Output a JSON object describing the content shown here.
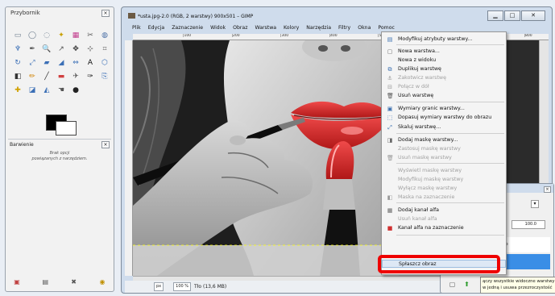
{
  "toolbox": {
    "title": "Przybornik",
    "tools": [
      {
        "name": "rect-select-icon",
        "glyph": "▭",
        "color": "#6b7b8c"
      },
      {
        "name": "ellipse-select-icon",
        "glyph": "◯",
        "color": "#6b7b8c"
      },
      {
        "name": "free-select-icon",
        "glyph": "◌",
        "color": "#6b7b8c"
      },
      {
        "name": "fuzzy-select-icon",
        "glyph": "✦",
        "color": "#c8a000"
      },
      {
        "name": "color-select-icon",
        "glyph": "▦",
        "color": "#c23b8c"
      },
      {
        "name": "scissors-icon",
        "glyph": "✂",
        "color": "#555555"
      },
      {
        "name": "foreground-select-icon",
        "glyph": "◍",
        "color": "#4a6fa5"
      },
      {
        "name": "paths-icon",
        "glyph": "♆",
        "color": "#3b6fb6"
      },
      {
        "name": "color-picker-icon",
        "glyph": "✒",
        "color": "#555555"
      },
      {
        "name": "zoom-icon",
        "glyph": "🔍",
        "color": "#3b6fb6"
      },
      {
        "name": "measure-icon",
        "glyph": "↗",
        "color": "#555555"
      },
      {
        "name": "move-icon",
        "glyph": "✥",
        "color": "#333333"
      },
      {
        "name": "align-icon",
        "glyph": "⊹",
        "color": "#333333"
      },
      {
        "name": "crop-icon",
        "glyph": "⌗",
        "color": "#666666"
      },
      {
        "name": "rotate-icon",
        "glyph": "↻",
        "color": "#3b6fb6"
      },
      {
        "name": "scale-icon",
        "glyph": "⤢",
        "color": "#3b6fb6"
      },
      {
        "name": "shear-icon",
        "glyph": "▰",
        "color": "#3b6fb6"
      },
      {
        "name": "perspective-icon",
        "glyph": "◢",
        "color": "#3b6fb6"
      },
      {
        "name": "flip-icon",
        "glyph": "⇔",
        "color": "#3b6fb6"
      },
      {
        "name": "text-icon",
        "glyph": "A",
        "color": "#111111"
      },
      {
        "name": "cage-icon",
        "glyph": "⬡",
        "color": "#3b6fb6"
      },
      {
        "name": "bucket-fill-icon",
        "glyph": "◧",
        "color": "#333333"
      },
      {
        "name": "pencil-icon",
        "glyph": "✏",
        "color": "#d08000"
      },
      {
        "name": "paintbrush-icon",
        "glyph": "╱",
        "color": "#333333"
      },
      {
        "name": "eraser-icon",
        "glyph": "▬",
        "color": "#d04040"
      },
      {
        "name": "airbrush-icon",
        "glyph": "✈",
        "color": "#555555"
      },
      {
        "name": "ink-icon",
        "glyph": "✑",
        "color": "#333333"
      },
      {
        "name": "clone-icon",
        "glyph": "⎘",
        "color": "#3b6fb6"
      },
      {
        "name": "heal-icon",
        "glyph": "✚",
        "color": "#d0a000"
      },
      {
        "name": "perspective-clone-icon",
        "glyph": "◪",
        "color": "#3b6fb6"
      },
      {
        "name": "blur-icon",
        "glyph": "◭",
        "color": "#3b6fb6"
      },
      {
        "name": "smudge-icon",
        "glyph": "☚",
        "color": "#555555"
      },
      {
        "name": "dodge-burn-icon",
        "glyph": "●",
        "color": "#222222"
      }
    ],
    "options_title": "Barwienie",
    "options_msg_line1": "Brak opcji",
    "options_msg_line2": "powiązanych z narzędziem.",
    "bottom_icons": [
      {
        "name": "save-options-icon",
        "glyph": "▣",
        "color": "#c04040"
      },
      {
        "name": "restore-options-icon",
        "glyph": "▤",
        "color": "#555555"
      },
      {
        "name": "delete-options-icon",
        "glyph": "✖",
        "color": "#555555"
      },
      {
        "name": "reset-options-icon",
        "glyph": "◉",
        "color": "#c09000"
      }
    ]
  },
  "window": {
    "title": "*usta.jpg-2.0 (RGB, 2 warstwy) 900x501 – GIMP",
    "controls": {
      "minimize": "▁",
      "maximize": "□",
      "close": "✕"
    }
  },
  "menubar": [
    "Plik",
    "Edycja",
    "Zaznaczenie",
    "Widok",
    "Obraz",
    "Warstwa",
    "Kolory",
    "Narzędzia",
    "Filtry",
    "Okna",
    "Pomoc"
  ],
  "ruler": [
    "|100",
    "|200",
    "|300",
    "|400",
    "|500",
    "|600",
    "|700",
    "|800"
  ],
  "statusbar": {
    "unit": "px",
    "zoom": "100 %",
    "message": "Tło (13,6 MB)"
  },
  "layers": {
    "opacity": "100.0",
    "rows": [
      {
        "label": "ie Tło"
      },
      {
        "label": ""
      }
    ],
    "buttons": [
      {
        "name": "new-layer-icon",
        "glyph": "▢",
        "color": "#555555"
      },
      {
        "name": "raise-layer-icon",
        "glyph": "⬆",
        "color": "#2a9a2a"
      }
    ]
  },
  "tooltip": {
    "line1": "ączy wszystkie widoczne warstwy",
    "line2": "w jedną i usuwa przezroczystość"
  },
  "context_menu": {
    "items": [
      {
        "label": "Modyfikuj atrybuty warstwy...",
        "icon": "▤",
        "color": "#3a6fb0",
        "enabled": true
      },
      {
        "label": "Nowa warstwa...",
        "icon": "▢",
        "color": "#666666",
        "enabled": true
      },
      {
        "label": "Nowa z widoku",
        "icon": "",
        "color": "#666666",
        "enabled": true
      },
      {
        "label": "Duplikuj warstwę",
        "icon": "⧉",
        "color": "#3a6fb0",
        "enabled": true
      },
      {
        "label": "Zakotwicz warstwę",
        "icon": "⚓",
        "color": "#999999",
        "enabled": false
      },
      {
        "label": "Połącz w dół",
        "icon": "⊟",
        "color": "#999999",
        "enabled": false
      },
      {
        "label": "Usuń warstwę",
        "icon": "🗑",
        "color": "#555555",
        "enabled": true
      },
      {
        "label": "Wymiary granic warstwy...",
        "icon": "▣",
        "color": "#3a6fb0",
        "enabled": true
      },
      {
        "label": "Dopasuj wymiary warstwy do obrazu",
        "icon": "⬚",
        "color": "#3a6fb0",
        "enabled": true
      },
      {
        "label": "Skaluj warstwę...",
        "icon": "⤢",
        "color": "#3a6fb0",
        "enabled": true
      },
      {
        "label": "Dodaj maskę warstwy...",
        "icon": "◨",
        "color": "#666666",
        "enabled": true
      },
      {
        "label": "Zastosuj maskę warstwy",
        "icon": "",
        "color": "#999999",
        "enabled": false
      },
      {
        "label": "Usuń maskę warstwy",
        "icon": "🗑",
        "color": "#999999",
        "enabled": false
      },
      {
        "label": "Wyświetl maskę warstwy",
        "icon": "",
        "color": "#999999",
        "enabled": false
      },
      {
        "label": "Modyfikuj maskę warstwy",
        "icon": "",
        "color": "#999999",
        "enabled": false
      },
      {
        "label": "Wyłącz maskę warstwy",
        "icon": "",
        "color": "#999999",
        "enabled": false
      },
      {
        "label": "Maska na zaznaczenie",
        "icon": "◧",
        "color": "#999999",
        "enabled": false
      },
      {
        "label": "Dodaj kanał alfa",
        "icon": "▦",
        "color": "#666666",
        "enabled": true
      },
      {
        "label": "Usuń kanał alfa",
        "icon": "",
        "color": "#999999",
        "enabled": false
      },
      {
        "label": "Kanał alfa na zaznaczenie",
        "icon": "■",
        "color": "#d03030",
        "enabled": true
      },
      {
        "label": "Spłaszcz obraz",
        "icon": "",
        "color": "#666666",
        "enabled": true,
        "active": true
      }
    ]
  }
}
